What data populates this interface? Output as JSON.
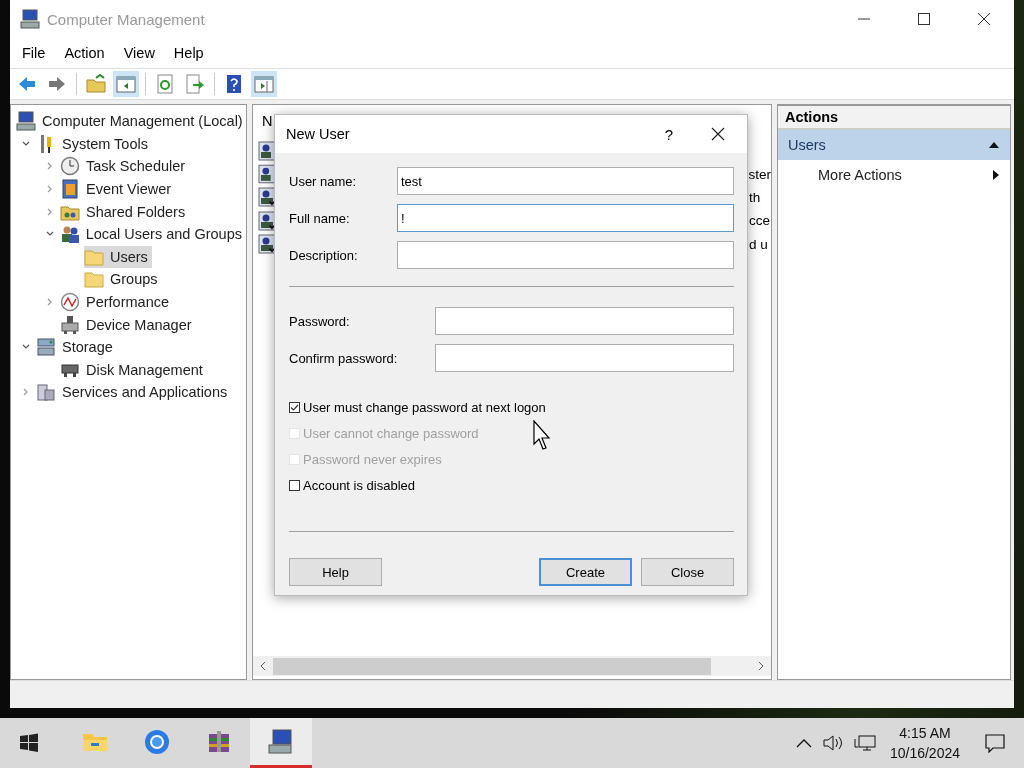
{
  "window": {
    "title": "Computer Management"
  },
  "menu": [
    {
      "label": "File"
    },
    {
      "label": "Action"
    },
    {
      "label": "View"
    },
    {
      "label": "Help"
    }
  ],
  "toolbar": [
    {
      "kind": "back",
      "pressed": false
    },
    {
      "kind": "forward",
      "pressed": false
    },
    {
      "kind": "sep"
    },
    {
      "kind": "up",
      "pressed": false
    },
    {
      "kind": "tree",
      "pressed": true
    },
    {
      "kind": "sep"
    },
    {
      "kind": "refresh",
      "pressed": false
    },
    {
      "kind": "export",
      "pressed": false
    },
    {
      "kind": "sep"
    },
    {
      "kind": "help",
      "pressed": false
    },
    {
      "kind": "pane",
      "pressed": true
    }
  ],
  "tree": [
    {
      "label": "Computer Management (Local)",
      "kind": "computer",
      "selected": false,
      "children": [
        {
          "label": "System Tools",
          "kind": "tools",
          "expanded": true,
          "selected": false,
          "children": [
            {
              "label": "Task Scheduler",
              "kind": "clock",
              "expanded": false,
              "selected": false
            },
            {
              "label": "Event Viewer",
              "kind": "event",
              "expanded": false,
              "selected": false
            },
            {
              "label": "Shared Folders",
              "kind": "shared",
              "expanded": false,
              "selected": false
            },
            {
              "label": "Local Users and Groups",
              "kind": "users",
              "expanded": true,
              "selected": false,
              "children": [
                {
                  "label": "Users",
                  "kind": "folder",
                  "selected": true
                },
                {
                  "label": "Groups",
                  "kind": "folder",
                  "selected": false
                }
              ]
            },
            {
              "label": "Performance",
              "kind": "perf",
              "expanded": false,
              "selected": false
            },
            {
              "label": "Device Manager",
              "kind": "device",
              "selected": false
            }
          ]
        },
        {
          "label": "Storage",
          "kind": "storage",
          "expanded": true,
          "selected": false,
          "children": [
            {
              "label": "Disk Management",
              "kind": "disk",
              "selected": false
            }
          ]
        },
        {
          "label": "Services and Applications",
          "kind": "services",
          "expanded": false,
          "selected": false
        }
      ]
    }
  ],
  "list": {
    "header": "N",
    "rows": [
      {
        "kind": "user"
      },
      {
        "kind": "user",
        "text": "ster"
      },
      {
        "kind": "user-down",
        "text": "th"
      },
      {
        "kind": "user-down",
        "text": "cce"
      },
      {
        "kind": "user-down",
        "text": "d u"
      }
    ]
  },
  "actions": {
    "title": "Actions",
    "sections": [
      {
        "label": "Users",
        "expanded": true,
        "items": [
          {
            "label": "More Actions"
          }
        ]
      }
    ]
  },
  "dialog": {
    "title": "New User",
    "help": "?",
    "groups": [
      [
        {
          "label": "User name:",
          "value": "test",
          "focused": false
        },
        {
          "label": "Full name:",
          "value": "!",
          "focused": true
        },
        {
          "label": "Description:",
          "focused": false
        }
      ],
      [
        {
          "label": "Password:",
          "focused": false
        },
        {
          "label": "Confirm password:",
          "focused": false
        }
      ]
    ],
    "checkboxes": [
      {
        "label": "User must change password at next logon",
        "checked": true,
        "disabled": false
      },
      {
        "label": "User cannot change password",
        "checked": false,
        "disabled": true
      },
      {
        "label": "Password never expires",
        "checked": false,
        "disabled": true
      },
      {
        "label": "Account is disabled",
        "checked": false,
        "disabled": false
      }
    ],
    "buttons": [
      {
        "label": "Help",
        "default": false
      },
      {
        "label": "Create",
        "default": true
      },
      {
        "label": "Close",
        "default": false
      }
    ]
  },
  "taskbar": {
    "apps": [
      {
        "kind": "explorer",
        "active": false
      },
      {
        "kind": "browser",
        "active": false
      },
      {
        "kind": "archive",
        "active": false
      },
      {
        "kind": "computer",
        "active": true
      }
    ],
    "time": "4:15 AM",
    "date": "10/16/2024"
  }
}
